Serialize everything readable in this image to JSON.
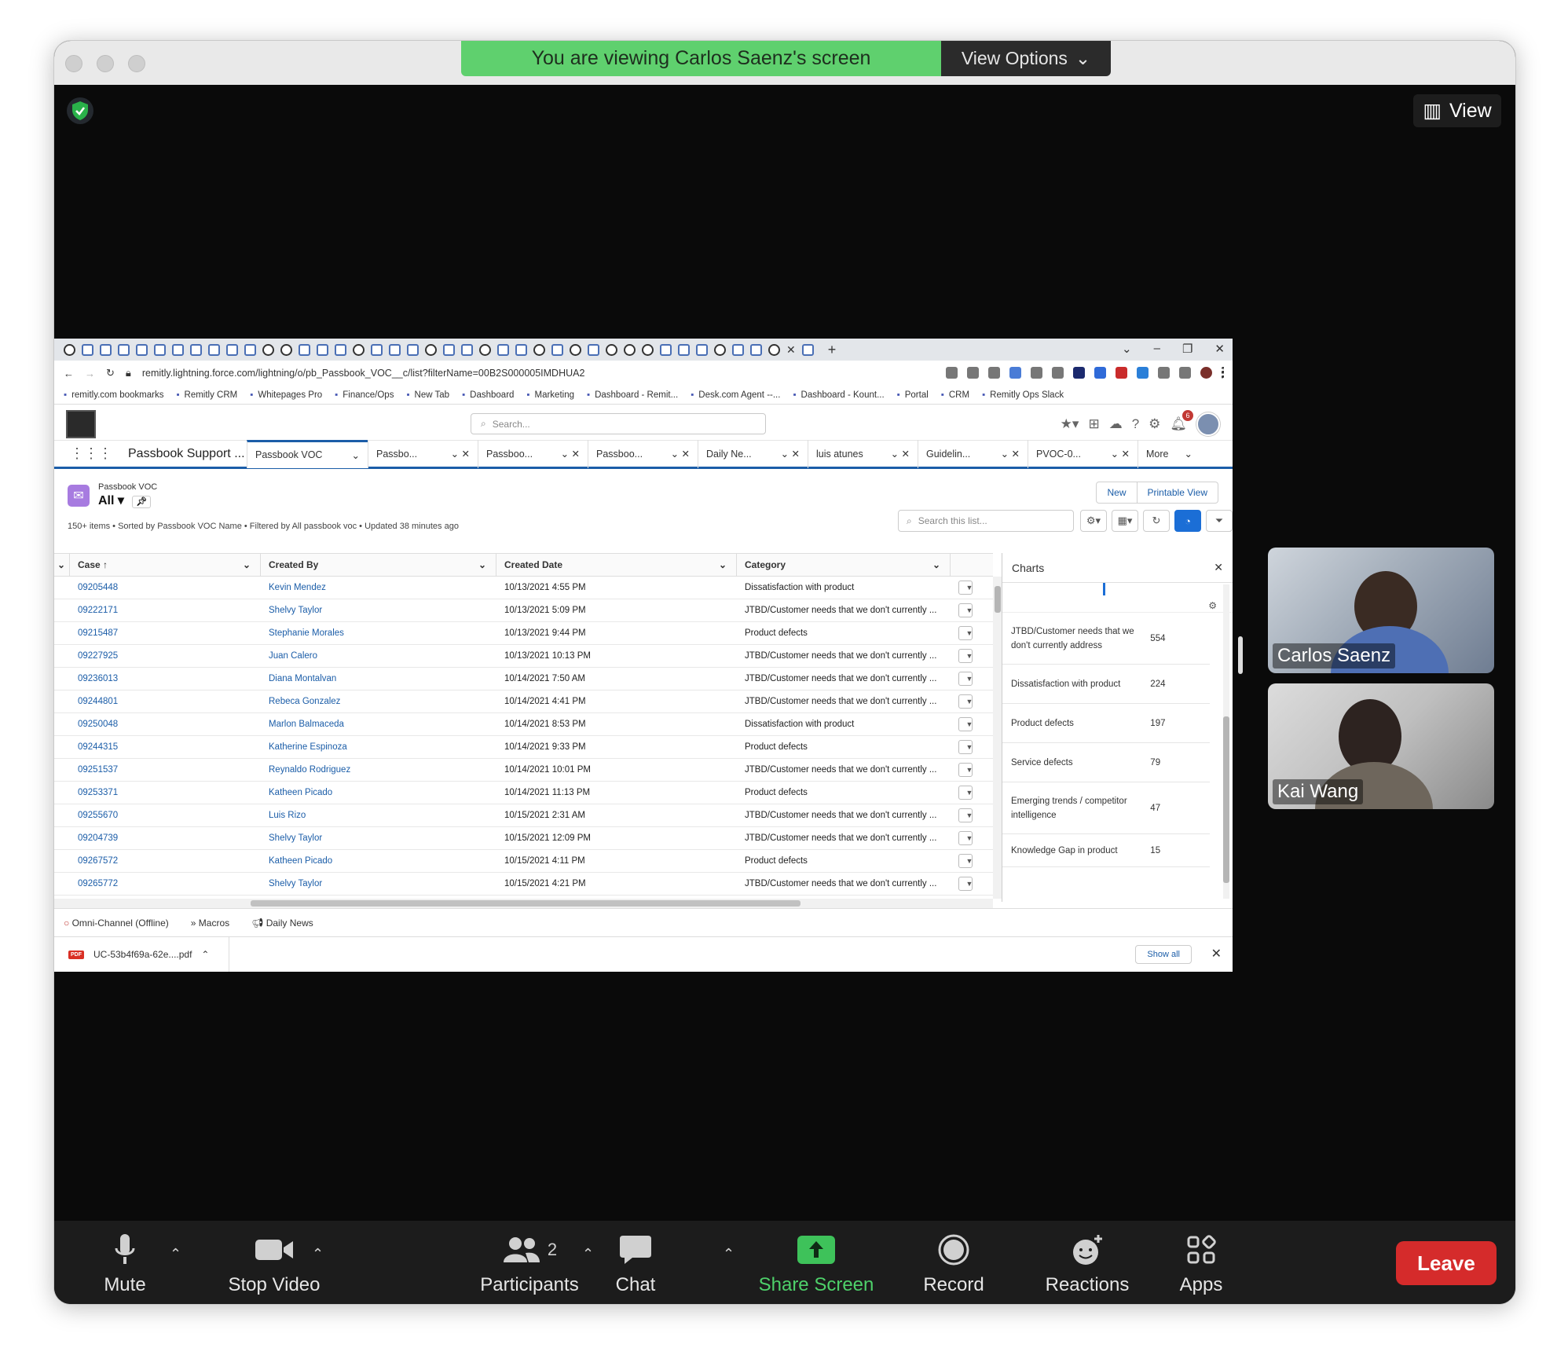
{
  "zoom": {
    "banner_text": "You are viewing Carlos Saenz's screen",
    "view_options_label": "View Options",
    "view_label": "View",
    "participants": [
      {
        "name": "Carlos Saenz"
      },
      {
        "name": "Kai Wang"
      }
    ],
    "toolbar": {
      "mute": "Mute",
      "stop_video": "Stop Video",
      "participants": "Participants",
      "participants_count": "2",
      "chat": "Chat",
      "share_screen": "Share Screen",
      "record": "Record",
      "reactions": "Reactions",
      "apps": "Apps",
      "leave": "Leave"
    }
  },
  "browser": {
    "url": "remitly.lightning.force.com/lightning/o/pb_Passbook_VOC__c/list?filterName=00B2S000005IMDHUA2",
    "bookmarks": [
      "remitly.com bookmarks",
      "Remitly CRM",
      "Whitepages Pro",
      "Finance/Ops",
      "New Tab",
      "Dashboard",
      "Marketing",
      "Dashboard - Remit...",
      "Desk.com Agent --...",
      "Dashboard - Kount...",
      "Portal",
      "CRM",
      "Remitly Ops Slack"
    ]
  },
  "salesforce": {
    "search_placeholder": "Search...",
    "notification_count": "6",
    "app_name": "Passbook Support ...",
    "nav_tabs": [
      "Passbook VOC",
      "Passbo...",
      "Passboo...",
      "Passboo...",
      "Daily Ne...",
      "luis atunes",
      "Guidelin...",
      "PVOC-0..."
    ],
    "more_label": "More",
    "object_label": "Passbook VOC",
    "list_view": "All",
    "list_meta": "150+ items • Sorted by Passbook VOC Name • Filtered by All passbook voc • Updated 38 minutes ago",
    "buttons": {
      "new": "New",
      "printable": "Printable View"
    },
    "list_search_placeholder": "Search this list...",
    "columns": {
      "case": "Case ↑",
      "created_by": "Created By",
      "created_date": "Created Date",
      "category": "Category"
    },
    "rows": [
      {
        "case": "09205448",
        "by": "Kevin Mendez",
        "date": "10/13/2021 4:55 PM",
        "cat": "Dissatisfaction with product"
      },
      {
        "case": "09222171",
        "by": "Shelvy Taylor",
        "date": "10/13/2021 5:09 PM",
        "cat": "JTBD/Customer needs that we don't currently ..."
      },
      {
        "case": "09215487",
        "by": "Stephanie Morales",
        "date": "10/13/2021 9:44 PM",
        "cat": "Product defects"
      },
      {
        "case": "09227925",
        "by": "Juan Calero",
        "date": "10/13/2021 10:13 PM",
        "cat": "JTBD/Customer needs that we don't currently ..."
      },
      {
        "case": "09236013",
        "by": "Diana Montalvan",
        "date": "10/14/2021 7:50 AM",
        "cat": "JTBD/Customer needs that we don't currently ..."
      },
      {
        "case": "09244801",
        "by": "Rebeca Gonzalez",
        "date": "10/14/2021 4:41 PM",
        "cat": "JTBD/Customer needs that we don't currently ..."
      },
      {
        "case": "09250048",
        "by": "Marlon Balmaceda",
        "date": "10/14/2021 8:53 PM",
        "cat": "Dissatisfaction with product"
      },
      {
        "case": "09244315",
        "by": "Katherine Espinoza",
        "date": "10/14/2021 9:33 PM",
        "cat": "Product defects"
      },
      {
        "case": "09251537",
        "by": "Reynaldo Rodriguez",
        "date": "10/14/2021 10:01 PM",
        "cat": "JTBD/Customer needs that we don't currently ..."
      },
      {
        "case": "09253371",
        "by": "Katheen Picado",
        "date": "10/14/2021 11:13 PM",
        "cat": "Product defects"
      },
      {
        "case": "09255670",
        "by": "Luis Rizo",
        "date": "10/15/2021 2:31 AM",
        "cat": "JTBD/Customer needs that we don't currently ..."
      },
      {
        "case": "09204739",
        "by": "Shelvy Taylor",
        "date": "10/15/2021 12:09 PM",
        "cat": "JTBD/Customer needs that we don't currently ..."
      },
      {
        "case": "09267572",
        "by": "Katheen Picado",
        "date": "10/15/2021 4:11 PM",
        "cat": "Product defects"
      },
      {
        "case": "09265772",
        "by": "Shelvy Taylor",
        "date": "10/15/2021 4:21 PM",
        "cat": "JTBD/Customer needs that we don't currently ..."
      }
    ],
    "charts_panel": {
      "title": "Charts",
      "items": [
        {
          "label": "JTBD/Customer needs that we don't currently address",
          "value": "554"
        },
        {
          "label": "Dissatisfaction with product",
          "value": "224"
        },
        {
          "label": "Product defects",
          "value": "197"
        },
        {
          "label": "Service defects",
          "value": "79"
        },
        {
          "label": "Emerging trends / competitor intelligence",
          "value": "47"
        },
        {
          "label": "Knowledge Gap in product",
          "value": "15"
        }
      ]
    },
    "utility_bar": [
      "Omni-Channel (Offline)",
      "Macros",
      "Daily News"
    ],
    "download": {
      "file": "UC-53b4f69a-62e....pdf",
      "show_all": "Show all"
    }
  }
}
